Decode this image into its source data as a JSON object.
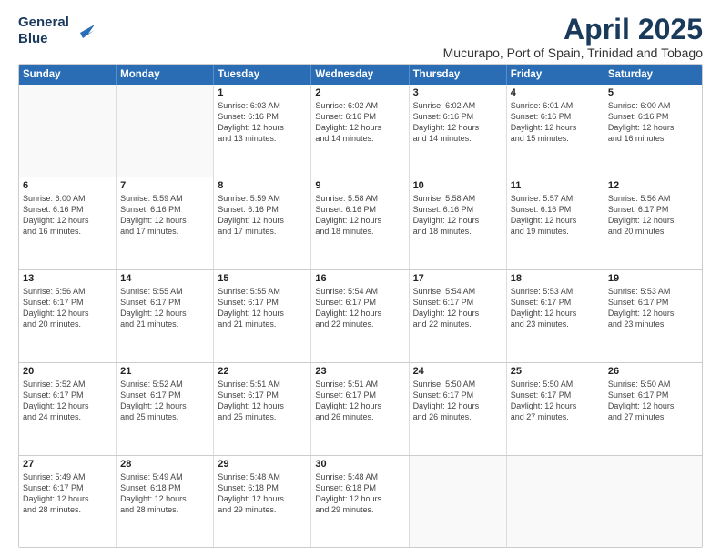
{
  "logo": {
    "line1": "General",
    "line2": "Blue"
  },
  "title": "April 2025",
  "location": "Mucurapo, Port of Spain, Trinidad and Tobago",
  "weekdays": [
    "Sunday",
    "Monday",
    "Tuesday",
    "Wednesday",
    "Thursday",
    "Friday",
    "Saturday"
  ],
  "rows": [
    [
      {
        "day": "",
        "info": ""
      },
      {
        "day": "",
        "info": ""
      },
      {
        "day": "1",
        "info": "Sunrise: 6:03 AM\nSunset: 6:16 PM\nDaylight: 12 hours\nand 13 minutes."
      },
      {
        "day": "2",
        "info": "Sunrise: 6:02 AM\nSunset: 6:16 PM\nDaylight: 12 hours\nand 14 minutes."
      },
      {
        "day": "3",
        "info": "Sunrise: 6:02 AM\nSunset: 6:16 PM\nDaylight: 12 hours\nand 14 minutes."
      },
      {
        "day": "4",
        "info": "Sunrise: 6:01 AM\nSunset: 6:16 PM\nDaylight: 12 hours\nand 15 minutes."
      },
      {
        "day": "5",
        "info": "Sunrise: 6:00 AM\nSunset: 6:16 PM\nDaylight: 12 hours\nand 16 minutes."
      }
    ],
    [
      {
        "day": "6",
        "info": "Sunrise: 6:00 AM\nSunset: 6:16 PM\nDaylight: 12 hours\nand 16 minutes."
      },
      {
        "day": "7",
        "info": "Sunrise: 5:59 AM\nSunset: 6:16 PM\nDaylight: 12 hours\nand 17 minutes."
      },
      {
        "day": "8",
        "info": "Sunrise: 5:59 AM\nSunset: 6:16 PM\nDaylight: 12 hours\nand 17 minutes."
      },
      {
        "day": "9",
        "info": "Sunrise: 5:58 AM\nSunset: 6:16 PM\nDaylight: 12 hours\nand 18 minutes."
      },
      {
        "day": "10",
        "info": "Sunrise: 5:58 AM\nSunset: 6:16 PM\nDaylight: 12 hours\nand 18 minutes."
      },
      {
        "day": "11",
        "info": "Sunrise: 5:57 AM\nSunset: 6:16 PM\nDaylight: 12 hours\nand 19 minutes."
      },
      {
        "day": "12",
        "info": "Sunrise: 5:56 AM\nSunset: 6:17 PM\nDaylight: 12 hours\nand 20 minutes."
      }
    ],
    [
      {
        "day": "13",
        "info": "Sunrise: 5:56 AM\nSunset: 6:17 PM\nDaylight: 12 hours\nand 20 minutes."
      },
      {
        "day": "14",
        "info": "Sunrise: 5:55 AM\nSunset: 6:17 PM\nDaylight: 12 hours\nand 21 minutes."
      },
      {
        "day": "15",
        "info": "Sunrise: 5:55 AM\nSunset: 6:17 PM\nDaylight: 12 hours\nand 21 minutes."
      },
      {
        "day": "16",
        "info": "Sunrise: 5:54 AM\nSunset: 6:17 PM\nDaylight: 12 hours\nand 22 minutes."
      },
      {
        "day": "17",
        "info": "Sunrise: 5:54 AM\nSunset: 6:17 PM\nDaylight: 12 hours\nand 22 minutes."
      },
      {
        "day": "18",
        "info": "Sunrise: 5:53 AM\nSunset: 6:17 PM\nDaylight: 12 hours\nand 23 minutes."
      },
      {
        "day": "19",
        "info": "Sunrise: 5:53 AM\nSunset: 6:17 PM\nDaylight: 12 hours\nand 23 minutes."
      }
    ],
    [
      {
        "day": "20",
        "info": "Sunrise: 5:52 AM\nSunset: 6:17 PM\nDaylight: 12 hours\nand 24 minutes."
      },
      {
        "day": "21",
        "info": "Sunrise: 5:52 AM\nSunset: 6:17 PM\nDaylight: 12 hours\nand 25 minutes."
      },
      {
        "day": "22",
        "info": "Sunrise: 5:51 AM\nSunset: 6:17 PM\nDaylight: 12 hours\nand 25 minutes."
      },
      {
        "day": "23",
        "info": "Sunrise: 5:51 AM\nSunset: 6:17 PM\nDaylight: 12 hours\nand 26 minutes."
      },
      {
        "day": "24",
        "info": "Sunrise: 5:50 AM\nSunset: 6:17 PM\nDaylight: 12 hours\nand 26 minutes."
      },
      {
        "day": "25",
        "info": "Sunrise: 5:50 AM\nSunset: 6:17 PM\nDaylight: 12 hours\nand 27 minutes."
      },
      {
        "day": "26",
        "info": "Sunrise: 5:50 AM\nSunset: 6:17 PM\nDaylight: 12 hours\nand 27 minutes."
      }
    ],
    [
      {
        "day": "27",
        "info": "Sunrise: 5:49 AM\nSunset: 6:17 PM\nDaylight: 12 hours\nand 28 minutes."
      },
      {
        "day": "28",
        "info": "Sunrise: 5:49 AM\nSunset: 6:18 PM\nDaylight: 12 hours\nand 28 minutes."
      },
      {
        "day": "29",
        "info": "Sunrise: 5:48 AM\nSunset: 6:18 PM\nDaylight: 12 hours\nand 29 minutes."
      },
      {
        "day": "30",
        "info": "Sunrise: 5:48 AM\nSunset: 6:18 PM\nDaylight: 12 hours\nand 29 minutes."
      },
      {
        "day": "",
        "info": ""
      },
      {
        "day": "",
        "info": ""
      },
      {
        "day": "",
        "info": ""
      }
    ]
  ]
}
